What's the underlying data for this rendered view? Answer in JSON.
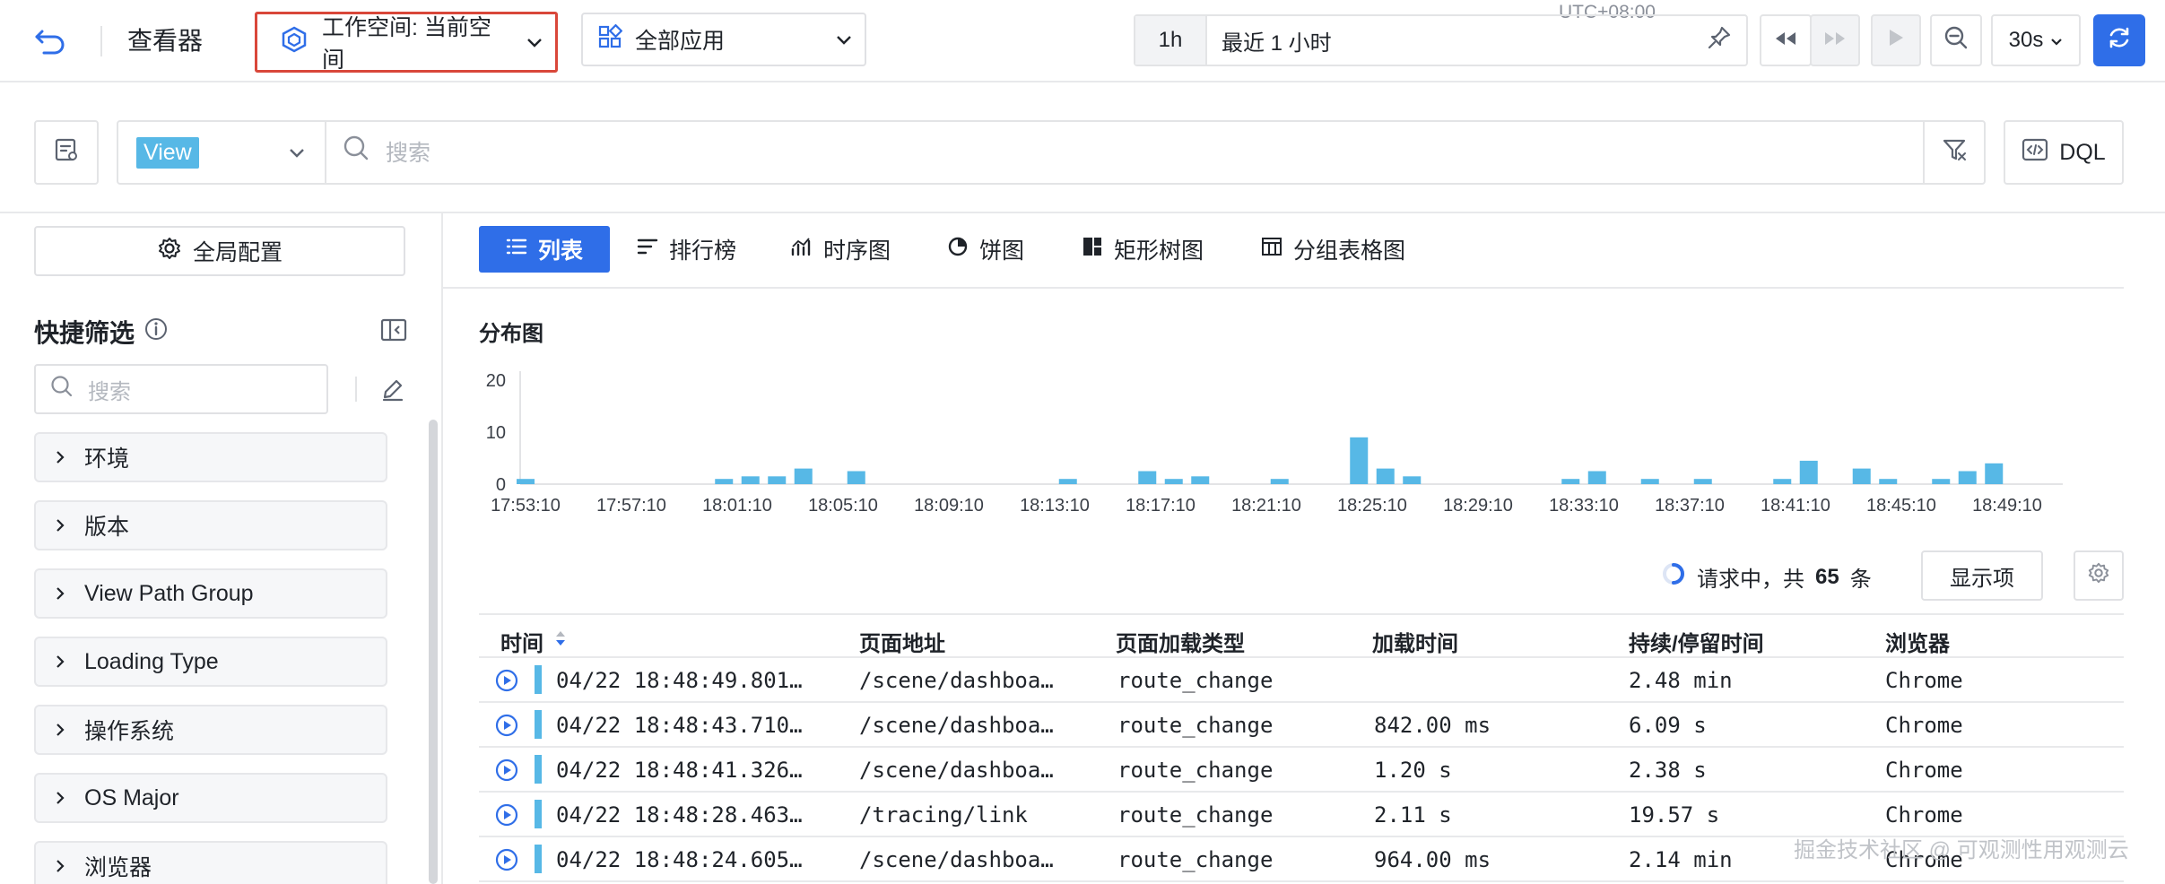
{
  "topbar": {
    "viewer_title": "查看器",
    "workspace_label": "工作空间: 当前空间",
    "apps_label": "全部应用",
    "timezone": "UTC+08:00",
    "time_preset": "1h",
    "time_range": "最近 1 小时",
    "refresh_interval": "30s"
  },
  "search": {
    "source_tag": "View",
    "placeholder": "搜索",
    "dql_label": "DQL"
  },
  "sidebar": {
    "global_config_label": "全局配置",
    "quick_filter_title": "快捷筛选",
    "search_placeholder": "搜索",
    "items": [
      {
        "label": "环境"
      },
      {
        "label": "版本"
      },
      {
        "label": "View Path Group"
      },
      {
        "label": "Loading Type"
      },
      {
        "label": "操作系统"
      },
      {
        "label": "OS Major"
      },
      {
        "label": "浏览器"
      }
    ]
  },
  "tabs": [
    {
      "label": "列表",
      "icon": "list-icon",
      "active": true
    },
    {
      "label": "排行榜",
      "icon": "ranking-icon",
      "active": false
    },
    {
      "label": "时序图",
      "icon": "timeseries-icon",
      "active": false
    },
    {
      "label": "饼图",
      "icon": "pie-icon",
      "active": false
    },
    {
      "label": "矩形树图",
      "icon": "treemap-icon",
      "active": false
    },
    {
      "label": "分组表格图",
      "icon": "grouped-table-icon",
      "active": false
    }
  ],
  "distribution": {
    "title": "分布图"
  },
  "chart_data": {
    "type": "bar",
    "title": "",
    "ylim": [
      0,
      20
    ],
    "yticks": [
      "20",
      "10",
      "0"
    ],
    "xtick_labels": [
      "17:53:10",
      "17:57:10",
      "18:01:10",
      "18:05:10",
      "18:09:10",
      "18:13:10",
      "18:17:10",
      "18:21:10",
      "18:25:10",
      "18:29:10",
      "18:33:10",
      "18:37:10",
      "18:41:10",
      "18:45:10",
      "18:49:10"
    ],
    "bars": [
      {
        "x": "17:53:10",
        "value": 1
      },
      {
        "x": "18:00:40",
        "value": 1
      },
      {
        "x": "18:01:40",
        "value": 1.5
      },
      {
        "x": "18:02:40",
        "value": 1.5
      },
      {
        "x": "18:03:40",
        "value": 3
      },
      {
        "x": "18:05:40",
        "value": 2.5
      },
      {
        "x": "18:13:40",
        "value": 1
      },
      {
        "x": "18:16:40",
        "value": 2.5
      },
      {
        "x": "18:17:40",
        "value": 1
      },
      {
        "x": "18:18:40",
        "value": 1.5
      },
      {
        "x": "18:21:40",
        "value": 1
      },
      {
        "x": "18:24:40",
        "value": 9
      },
      {
        "x": "18:25:40",
        "value": 3
      },
      {
        "x": "18:26:40",
        "value": 1.5
      },
      {
        "x": "18:32:40",
        "value": 1
      },
      {
        "x": "18:33:40",
        "value": 2.5
      },
      {
        "x": "18:35:40",
        "value": 1
      },
      {
        "x": "18:37:40",
        "value": 1
      },
      {
        "x": "18:40:40",
        "value": 1
      },
      {
        "x": "18:41:40",
        "value": 4.5
      },
      {
        "x": "18:43:40",
        "value": 3
      },
      {
        "x": "18:44:40",
        "value": 1
      },
      {
        "x": "18:46:40",
        "value": 1
      },
      {
        "x": "18:47:40",
        "value": 2.5
      },
      {
        "x": "18:48:40",
        "value": 4
      },
      {
        "x": "18:50:40",
        "value": 0
      }
    ],
    "color": "#57b8e6"
  },
  "status": {
    "prefix": "请求中，共",
    "count": "65",
    "suffix": "条",
    "display_button": "显示项"
  },
  "table": {
    "columns": [
      "时间",
      "页面地址",
      "页面加载类型",
      "加载时间",
      "持续/停留时间",
      "浏览器"
    ],
    "rows": [
      {
        "time": "04/22 18:48:49.801…",
        "path": "/scene/dashboa…",
        "type": "route_change",
        "load": "",
        "duration": "2.48 min",
        "browser": "Chrome"
      },
      {
        "time": "04/22 18:48:43.710…",
        "path": "/scene/dashboa…",
        "type": "route_change",
        "load": "842.00 ms",
        "duration": "6.09 s",
        "browser": "Chrome"
      },
      {
        "time": "04/22 18:48:41.326…",
        "path": "/scene/dashboa…",
        "type": "route_change",
        "load": "1.20 s",
        "duration": "2.38 s",
        "browser": "Chrome"
      },
      {
        "time": "04/22 18:48:28.463…",
        "path": "/tracing/link",
        "type": "route_change",
        "load": "2.11 s",
        "duration": "19.57 s",
        "browser": "Chrome"
      },
      {
        "time": "04/22 18:48:24.605…",
        "path": "/scene/dashboa…",
        "type": "route_change",
        "load": "964.00 ms",
        "duration": "2.14 min",
        "browser": "Chrome"
      }
    ]
  },
  "watermark": "掘金技术社区 @ 可观测性用观测云",
  "colors": {
    "accent": "#2f6ee8",
    "bar": "#57b8e6",
    "highlight_border": "#d9473a"
  }
}
